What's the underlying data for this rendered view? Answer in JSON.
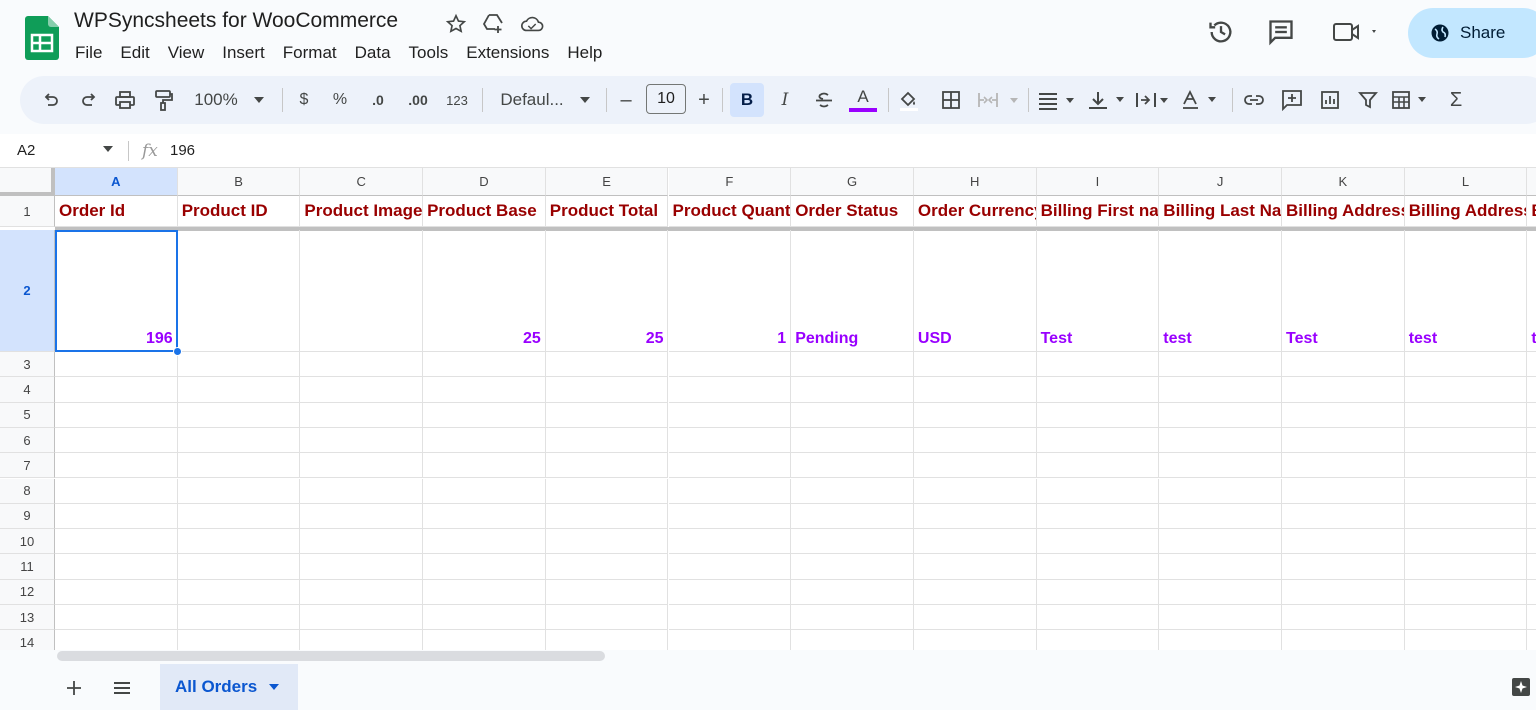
{
  "app": {
    "doc_title": "WPSyncsheets for WooCommerce",
    "menu": [
      "File",
      "Edit",
      "View",
      "Insert",
      "Format",
      "Data",
      "Tools",
      "Extensions",
      "Help"
    ],
    "share_label": "Share"
  },
  "toolbar": {
    "zoom": "100%",
    "currency": "$",
    "percent": "%",
    "decrease_decimal": ".0",
    "increase_decimal": ".00",
    "more_formats": "123",
    "font": "Defaul...",
    "font_size": "10",
    "minus": "–",
    "plus": "+",
    "bold": "B",
    "italic": "I",
    "text_color": "A",
    "sum": "Σ",
    "text_color_hex": "#9900ff"
  },
  "formula_bar": {
    "cell_ref": "A2",
    "fx": "fx",
    "value": "196"
  },
  "grid": {
    "columns": [
      "A",
      "B",
      "C",
      "D",
      "E",
      "F",
      "G",
      "H",
      "I",
      "J",
      "K",
      "L"
    ],
    "rows": [
      "1",
      "2",
      "3",
      "4",
      "5",
      "6",
      "7",
      "8",
      "9",
      "10",
      "11",
      "12",
      "13",
      "14"
    ],
    "header_row": [
      "Order Id",
      "Product ID",
      "Product Image",
      "Product Base",
      "Product Total",
      "Product Quantity",
      "Order Status",
      "Order Currency",
      "Billing First name",
      "Billing Last Name",
      "Billing Address",
      "Billing Address",
      "B"
    ],
    "data_row": [
      "196",
      "",
      "",
      "25",
      "25",
      "1",
      "Pending",
      "USD",
      "Test",
      "test",
      "Test",
      "test",
      "t"
    ],
    "header_color": "#990000",
    "data_color": "#9900ff"
  },
  "sheets": {
    "active_tab": "All Orders"
  }
}
